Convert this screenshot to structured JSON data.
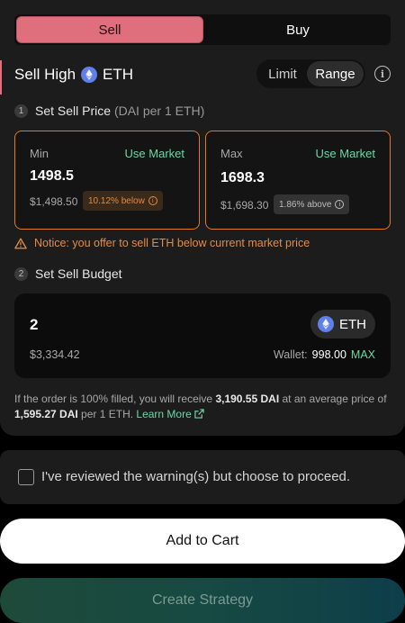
{
  "tabs": {
    "sell": "Sell",
    "buy": "Buy"
  },
  "header": {
    "title": "Sell High",
    "token": "ETH"
  },
  "mode_toggle": {
    "limit": "Limit",
    "range": "Range"
  },
  "step1": {
    "number": "1",
    "label": "Set Sell Price",
    "unit": "(DAI per 1 ETH)"
  },
  "min_card": {
    "label": "Min",
    "use_market": "Use Market",
    "value": "1498.5",
    "fiat": "$1,498.50",
    "badge": "10.12% below"
  },
  "max_card": {
    "label": "Max",
    "use_market": "Use Market",
    "value": "1698.3",
    "fiat": "$1,698.30",
    "badge": "1.86% above"
  },
  "notice": "Notice: you offer to sell ETH below current market price",
  "step2": {
    "number": "2",
    "label": "Set Sell Budget"
  },
  "budget": {
    "amount": "2",
    "token": "ETH",
    "fiat": "$3,334.42",
    "wallet_label": "Wallet:",
    "wallet_value": "998.00",
    "max": "MAX"
  },
  "summary": {
    "p1": "If the order is 100% filled, you will receive ",
    "receive": "3,190.55 DAI",
    "p2": " at an average price of ",
    "avg_price": "1,595.27 DAI",
    "p3": " per 1 ETH. ",
    "learn_more": "Learn More"
  },
  "confirm_text": "I've reviewed the warning(s) but choose to proceed.",
  "buttons": {
    "add_to_cart": "Add to Cart",
    "create_strategy": "Create Strategy"
  },
  "colors": {
    "sell_accent": "#df6f7c",
    "warning_orange": "#e07a23",
    "green": "#6ad7a4",
    "eth_blue": "#5f7fe9"
  }
}
